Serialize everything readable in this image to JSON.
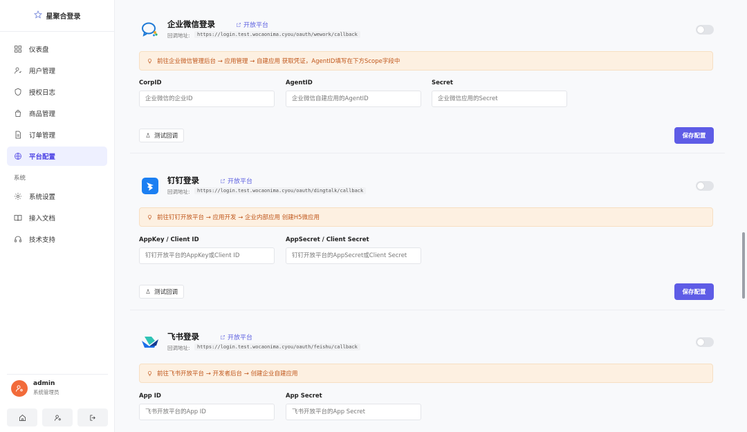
{
  "sidebar": {
    "brand": "星聚合登录",
    "items": [
      {
        "label": "仪表盘",
        "icon": "dashboard-icon"
      },
      {
        "label": "用户管理",
        "icon": "user-icon"
      },
      {
        "label": "授权日志",
        "icon": "shield-icon"
      },
      {
        "label": "商品管理",
        "icon": "bag-icon"
      },
      {
        "label": "订单管理",
        "icon": "document-icon"
      },
      {
        "label": "平台配置",
        "icon": "globe-icon",
        "active": true
      }
    ],
    "section_label": "系统",
    "system_items": [
      {
        "label": "系统设置",
        "icon": "gear-icon"
      },
      {
        "label": "接入文档",
        "icon": "book-icon"
      },
      {
        "label": "技术支持",
        "icon": "headset-icon"
      }
    ],
    "user": {
      "name": "admin",
      "role": "系统管理员"
    }
  },
  "common": {
    "open_platform": "开放平台",
    "callback_label": "回调地址:",
    "test_label": "测试回调",
    "save_label": "保存配置"
  },
  "wework": {
    "title": "企业微信登录",
    "callback": "https://login.test.wocaonima.cyou/oauth/wework/callback",
    "hint": "前往企业微信管理后台 → 应用管理 → 自建应用 获取凭证，AgentID填写在下方Scope字段中",
    "fields": [
      {
        "label": "CorpID",
        "placeholder": "企业微信的企业ID"
      },
      {
        "label": "AgentID",
        "placeholder": "企业微信自建应用的AgentID"
      },
      {
        "label": "Secret",
        "placeholder": "企业微信应用的Secret"
      }
    ]
  },
  "dingtalk": {
    "title": "钉钉登录",
    "callback": "https://login.test.wocaonima.cyou/oauth/dingtalk/callback",
    "hint": "前往钉钉开放平台 → 应用开发 → 企业内部应用 创建H5微应用",
    "fields": [
      {
        "label": "AppKey / Client ID",
        "placeholder": "钉钉开放平台的AppKey或Client ID"
      },
      {
        "label": "AppSecret / Client Secret",
        "placeholder": "钉钉开放平台的AppSecret或Client Secret"
      }
    ]
  },
  "feishu": {
    "title": "飞书登录",
    "callback": "https://login.test.wocaonima.cyou/oauth/feishu/callback",
    "hint": "前往飞书开放平台 → 开发者后台 → 创建企业自建应用",
    "fields": [
      {
        "label": "App ID",
        "placeholder": "飞书开放平台的App ID"
      },
      {
        "label": "App Secret",
        "placeholder": "飞书开放平台的App Secret"
      }
    ]
  },
  "colors": {
    "accent": "#5e5ce6",
    "hint_bg": "#fdf0e1",
    "hint_text": "#c0561a",
    "avatar": "#f26b3a"
  }
}
